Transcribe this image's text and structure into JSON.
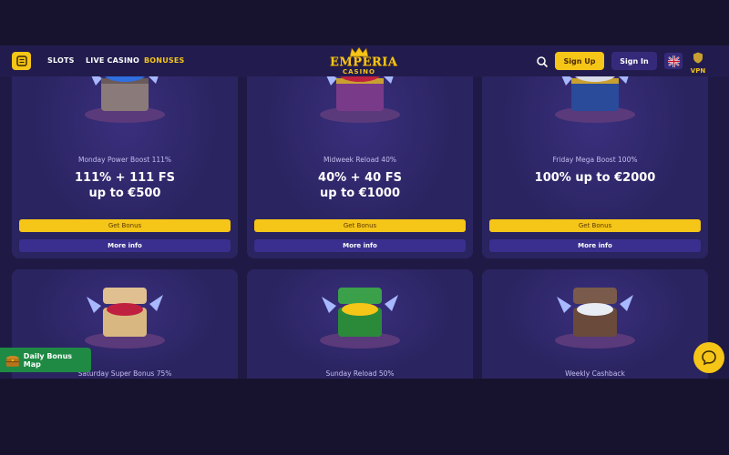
{
  "header": {
    "nav": [
      "SLOTS",
      "LIVE CASINO",
      "BONUSES"
    ],
    "logo_line1": "EMPERIA",
    "logo_line2": "CASINO",
    "signup_label": "Sign Up",
    "signin_label": "Sign In",
    "vpn_label": "VPN"
  },
  "cards": [
    {
      "title": "Monday Power Boost 111%",
      "amount_line1": "111% + 111 FS",
      "amount_line2": "up to €500",
      "get_label": "Get Bonus",
      "more_label": "More info",
      "chest": "blue-gems"
    },
    {
      "title": "Midweek Reload 40%",
      "amount_line1": "40% + 40 FS",
      "amount_line2": "up to €1000",
      "get_label": "Get Bonus",
      "more_label": "More info",
      "chest": "red-gems"
    },
    {
      "title": "Friday Mega Boost 100%",
      "amount_line1": "100% up to €2000",
      "amount_line2": "",
      "get_label": "Get Bonus",
      "more_label": "More info",
      "chest": "silver-coins"
    },
    {
      "title": "Saturday Super Bonus 75%",
      "chest": "red-gems"
    },
    {
      "title": "Sunday Reload 50%",
      "chest": "gold-coins"
    },
    {
      "title": "Weekly Cashback",
      "chest": "silver-coins"
    }
  ],
  "daily_map_label": "Daily Bonus Map",
  "colors": {
    "accent": "#f5c518",
    "card": "#2a2460",
    "header": "#221c4e",
    "page": "#1f1a45",
    "green": "#1f8a44"
  }
}
